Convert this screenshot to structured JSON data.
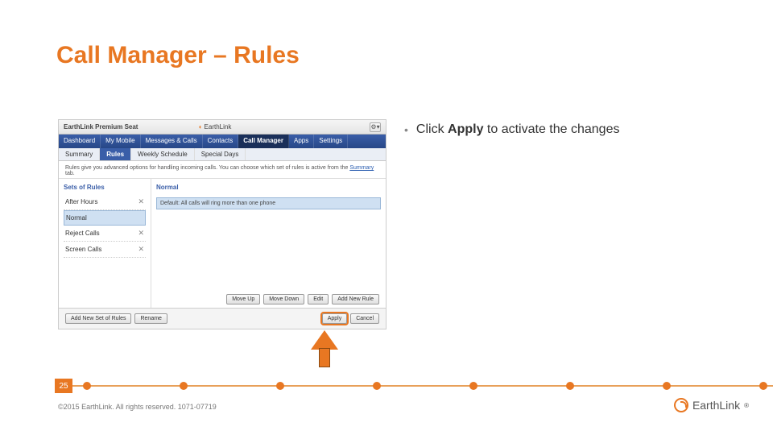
{
  "title": "Call Manager – Rules",
  "bullet": {
    "pre": "Click ",
    "bold": "Apply",
    "post": " to activate the changes"
  },
  "shot": {
    "titlebar": "EarthLink Premium Seat",
    "brand": "EarthLink",
    "nav": [
      "Dashboard",
      "My Mobile",
      "Messages & Calls",
      "Contacts",
      "Call Manager",
      "Apps",
      "Settings"
    ],
    "nav_active_index": 4,
    "subnav": [
      "Summary",
      "Rules",
      "Weekly Schedule",
      "Special Days"
    ],
    "subnav_active_index": 1,
    "desc_pre": "Rules give you advanced options for handling incoming calls. You can choose which set of rules is active from the ",
    "desc_link": "Summary",
    "desc_post": " tab.",
    "sets_header": "Sets of Rules",
    "normal_header": "Normal",
    "sets": [
      "After Hours",
      "Normal",
      "Reject Calls",
      "Screen Calls"
    ],
    "selected_set_index": 1,
    "default_rule": "Default: All calls will ring more than one phone",
    "list_buttons": [
      "Move Up",
      "Move Down",
      "Edit",
      "Add New Rule"
    ],
    "bottom_left": [
      "Add New Set of Rules",
      "Rename"
    ],
    "bottom_right": [
      "Apply",
      "Cancel"
    ]
  },
  "page_number": "25",
  "copyright": "©2015 EarthLink. All rights reserved. 1071-07719",
  "footer_brand": "EarthLink",
  "timeline_dots": [
    108,
    228,
    348,
    468,
    588,
    708,
    828,
    948
  ]
}
